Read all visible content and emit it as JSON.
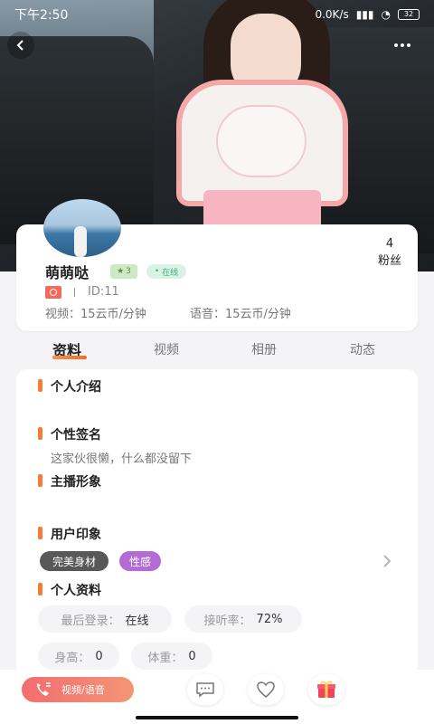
{
  "status_bar": {
    "time": "下午2:50",
    "net_speed": "0.0K/s",
    "battery": "32"
  },
  "profile": {
    "name": "萌萌哒",
    "level": "3",
    "online_label": "在线",
    "fans_count": "4",
    "fans_label": "粉丝",
    "id_text": "ID:11",
    "video_price": "视频：15云币/分钟",
    "voice_price": "语音：15云币/分钟"
  },
  "tabs": [
    {
      "label": "资料",
      "active": true
    },
    {
      "label": "视频",
      "active": false
    },
    {
      "label": "相册",
      "active": false
    },
    {
      "label": "动态",
      "active": false
    }
  ],
  "sections": {
    "intro_title": "个人介绍",
    "signature_title": "个性签名",
    "signature_text": "这家伙很懒，什么都没留下",
    "image_title": "主播形象",
    "impression_title": "用户印象",
    "impression_tags": [
      "完美身材",
      "性感"
    ],
    "info_title": "个人资料"
  },
  "info": {
    "last_login_label": "最后登录：",
    "last_login_value": "在线",
    "answer_rate_label": "接听率：",
    "answer_rate_value": "72%",
    "height_label": "身高：",
    "height_value": "0",
    "weight_label": "体重：",
    "weight_value": "0"
  },
  "bottom": {
    "call_label": "视频/语音"
  },
  "colors": {
    "accent": "#f47c36",
    "call_start": "#f26d6f",
    "call_end": "#f49576",
    "online": "#3fae7b",
    "tag_purple": "#b46bd6",
    "tag_dark": "#585858"
  },
  "icons": [
    "back-arrow-icon",
    "more-dots-icon",
    "star-icon",
    "tag-icon",
    "chevron-right-icon",
    "phone-icon",
    "chat-icon",
    "heart-icon",
    "gift-icon"
  ]
}
